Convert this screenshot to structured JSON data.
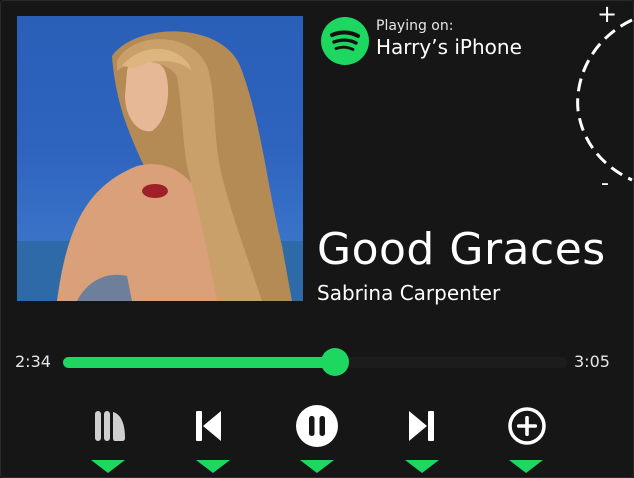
{
  "device": {
    "playing_on_label": "Playing on:",
    "name": "Harry’s iPhone"
  },
  "volume": {
    "plus_label": "+",
    "minus_label": "-"
  },
  "track": {
    "title": "Good Graces",
    "artist": "Sabrina Carpenter"
  },
  "progress": {
    "elapsed": "2:34",
    "total": "3:05",
    "fraction": 0.5405
  },
  "controls": [
    {
      "name": "library-button",
      "icon": "library-icon"
    },
    {
      "name": "previous-track-button",
      "icon": "skip-previous-icon"
    },
    {
      "name": "pause-button",
      "icon": "pause-icon"
    },
    {
      "name": "next-track-button",
      "icon": "skip-next-icon"
    },
    {
      "name": "add-to-library-button",
      "icon": "add-circle-icon"
    }
  ],
  "colors": {
    "accent": "#1ed760",
    "background": "#161616",
    "text": "#ffffff"
  }
}
